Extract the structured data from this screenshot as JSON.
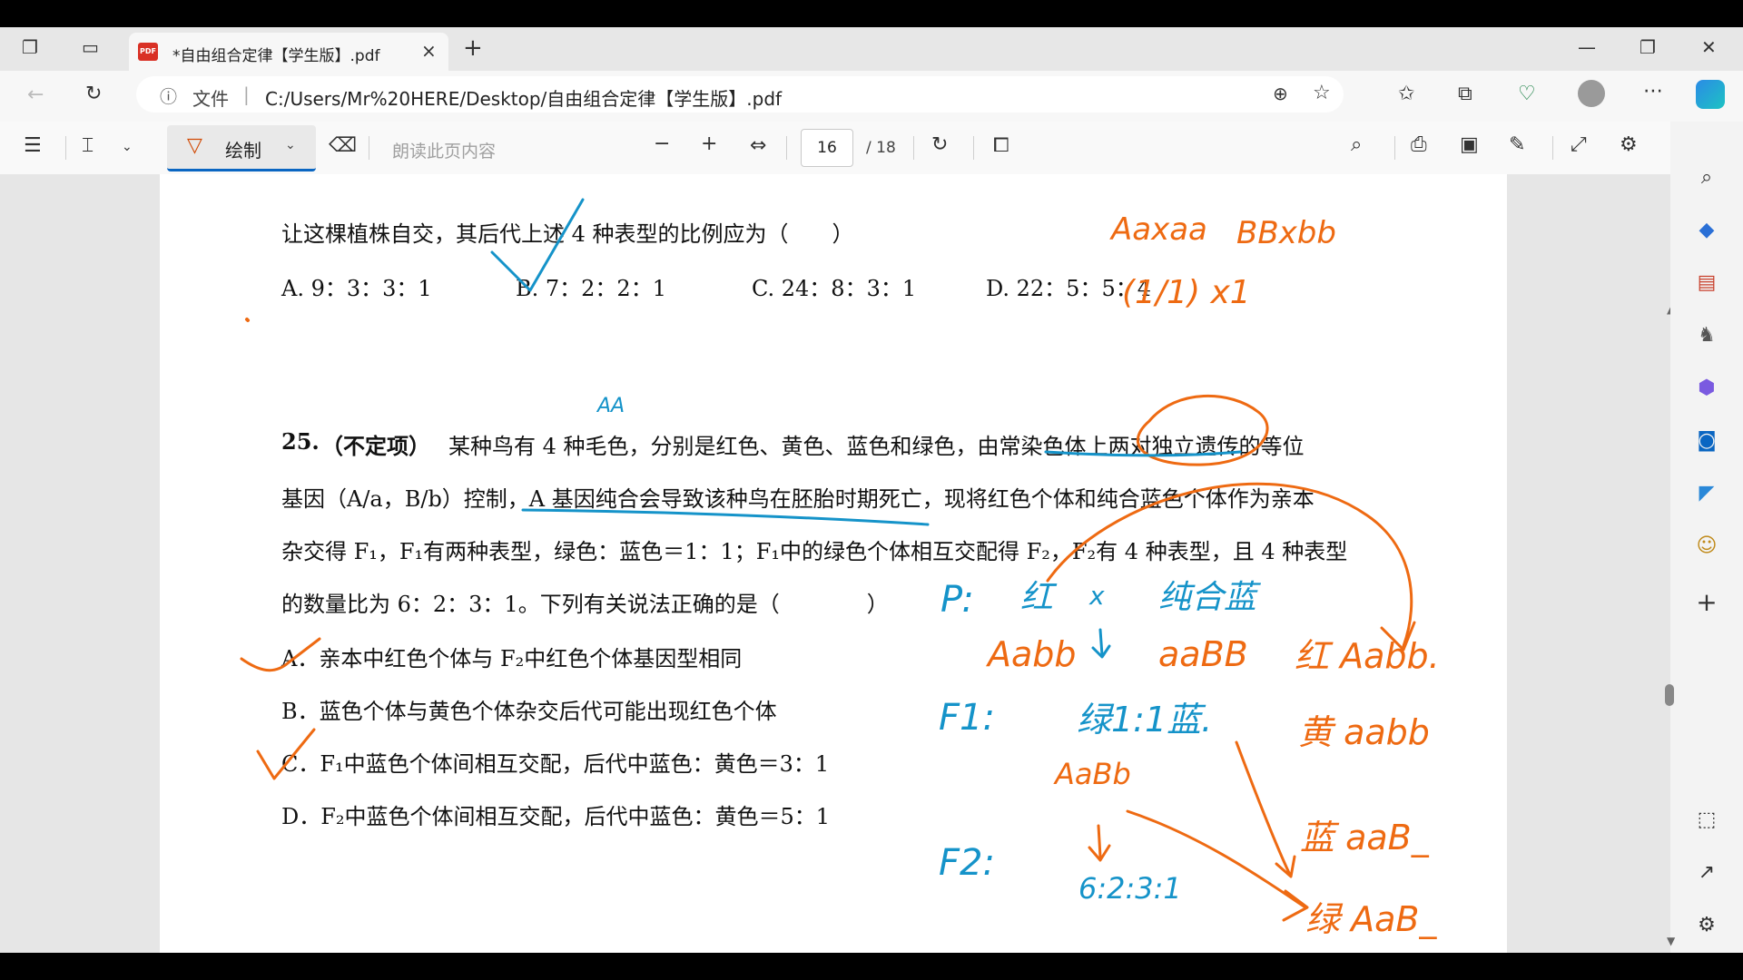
{
  "browser": {
    "tab_title": "*自由组合定律【学生版】.pdf",
    "tab_close": "×",
    "new_tab": "+",
    "pdf_badge": "PDF",
    "address_label": "文件",
    "address_sep": "|",
    "url": "C:/Users/Mr%20HERE/Desktop/自由组合定律【学生版】.pdf"
  },
  "pdf_toolbar": {
    "draw_label": "绘制",
    "read_aloud_placeholder": "朗读此页内容",
    "page_current": "16",
    "page_total": "/ 18"
  },
  "document": {
    "q24_stem": "让这棵植株自交，其后代上述 4 种表型的比例应为（　　）",
    "q24_options": [
      "A. 9：3：3：1",
      "B. 7：2：2：1",
      "C. 24：8：3：1",
      "D. 22：5：5：4"
    ],
    "q25_number": "25.",
    "q25_tag": "（不定项）",
    "q25_lines": [
      "某种鸟有 4 种毛色，分别是红色、黄色、蓝色和绿色，由常染色体上两对独立遗传的等位",
      "基因（A/a，B/b）控制，A 基因纯合会导致该种鸟在胚胎时期死亡，现将红色个体和纯合蓝色个体作为亲本",
      "杂交得 F₁，F₁有两种表型，绿色：蓝色＝1：1；F₁中的绿色个体相互交配得 F₂，F₂有 4 种表型，且 4 种表型",
      "的数量比为 6：2：3：1。下列有关说法正确的是（　　　　）"
    ],
    "q25_options": [
      "A．亲本中红色个体与 F₂中红色个体基因型相同",
      "B．蓝色个体与黄色个体杂交后代可能出现红色个体",
      "C．F₁中蓝色个体间相互交配，后代中蓝色：黄色＝3：1",
      "D．F₂中蓝色个体间相互交配，后代中蓝色：黄色＝5：1"
    ]
  },
  "ink_colors": {
    "orange": "#ee6a12",
    "blue": "#1593c9"
  },
  "annotations": [
    "Aaxaa",
    "BBxbb",
    "(1/1) x1",
    "AA",
    "P:",
    "红",
    "x",
    "纯合蓝",
    "Aabb",
    "aaBB",
    "红 Aabb.",
    "F1:",
    "绿1:1蓝.",
    "黄 aabb",
    "AaBb",
    "蓝 aaB_",
    "F2:",
    "6:2:3:1",
    "绿 AaB_"
  ]
}
